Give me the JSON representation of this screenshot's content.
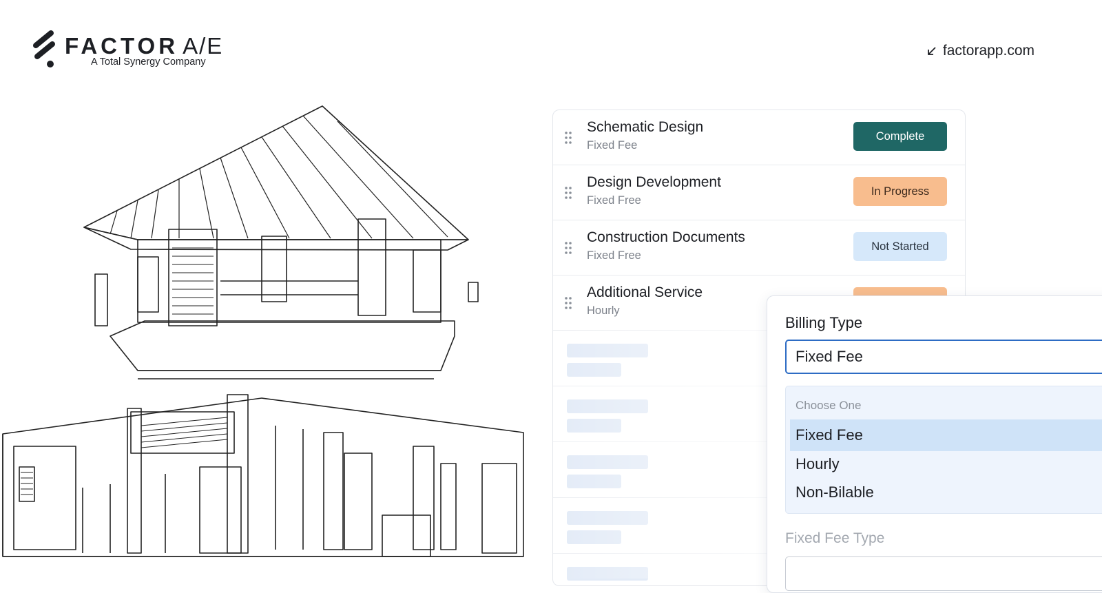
{
  "header": {
    "brand_primary": "FACTOR",
    "brand_suffix": "A/E",
    "tagline": "A Total Synergy Company",
    "site_link": "factorapp.com",
    "link_icon": "arrow-down-left-icon"
  },
  "phases": [
    {
      "name": "Schematic Design",
      "type": "Fixed Fee",
      "status": "Complete"
    },
    {
      "name": "Design Development",
      "type": "Fixed Free",
      "status": "In Progress"
    },
    {
      "name": "Construction Documents",
      "type": "Fixed Free",
      "status": "Not Started"
    },
    {
      "name": "Additional Service",
      "type": "Hourly",
      "status": ""
    }
  ],
  "billing": {
    "label": "Billing Type",
    "value": "Fixed Fee",
    "dropdown_header": "Choose One",
    "options": [
      "Fixed Fee",
      "Hourly",
      "Non-Bilable"
    ],
    "selected": "Fixed Fee",
    "fixed_fee_type_label": "Fixed Fee Type"
  },
  "colors": {
    "complete": "#1f6765",
    "in_progress": "#f8bd8e",
    "not_started": "#d6e8fa",
    "input_focus": "#2d6cc4",
    "dropdown_bg": "#eef4fd",
    "selected_option": "#cfe3f8"
  }
}
